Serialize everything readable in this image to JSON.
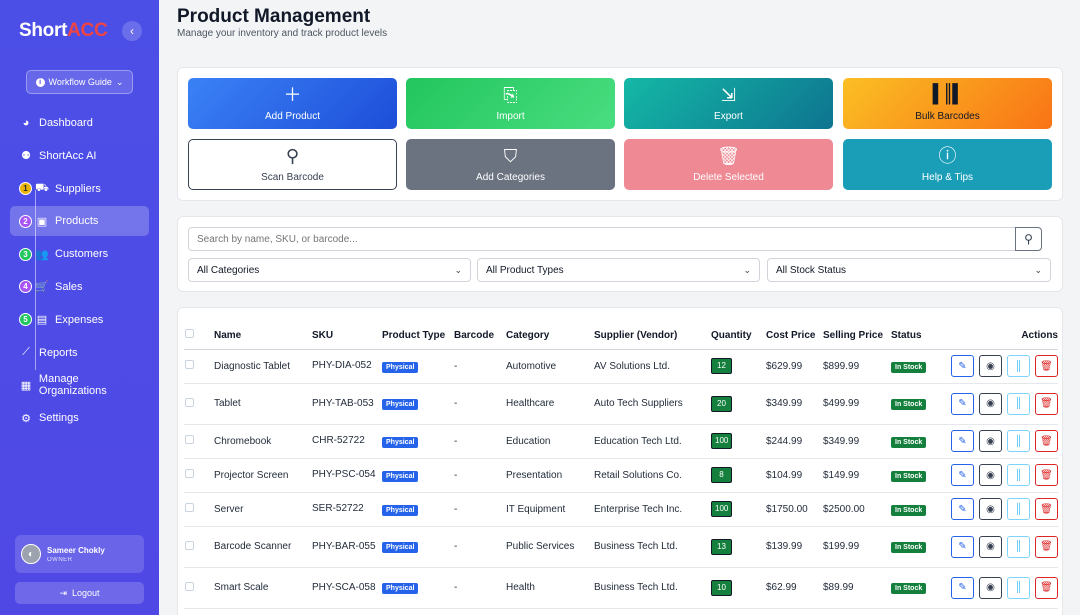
{
  "brand": {
    "part1": "Short",
    "part2": "ACC"
  },
  "sidebar": {
    "workflow_label": "Workflow Guide",
    "items": [
      {
        "label": "Dashboard",
        "icon": "palette-icon"
      },
      {
        "label": "ShortAcc AI",
        "icon": "robot-icon"
      },
      {
        "label": "Suppliers",
        "icon": "truck-icon",
        "step": "1"
      },
      {
        "label": "Products",
        "icon": "box-icon",
        "step": "2",
        "active": true
      },
      {
        "label": "Customers",
        "icon": "users-icon",
        "step": "3"
      },
      {
        "label": "Sales",
        "icon": "cart-icon",
        "step": "4"
      },
      {
        "label": "Expenses",
        "icon": "money-icon",
        "step": "5"
      },
      {
        "label": "Reports",
        "icon": "chart-icon"
      },
      {
        "label": "Manage Organizations",
        "icon": "building-icon"
      },
      {
        "label": "Settings",
        "icon": "gear-icon"
      }
    ],
    "user": {
      "name": "Sameer Chokly",
      "role": "OWNER"
    },
    "logout": "Logout"
  },
  "header": {
    "title": "Product Management",
    "subtitle": "Manage your inventory and track product levels"
  },
  "actions": {
    "add": "Add Product",
    "import": "Import",
    "export": "Export",
    "bulk": "Bulk Barcodes",
    "scan": "Scan Barcode",
    "categories": "Add Categories",
    "delete": "Delete Selected",
    "help": "Help & Tips"
  },
  "filters": {
    "search_placeholder": "Search by name, SKU, or barcode...",
    "category": "All Categories",
    "type": "All Product Types",
    "stock": "All Stock Status"
  },
  "table": {
    "headers": {
      "name": "Name",
      "sku": "SKU",
      "type": "Product Type",
      "barcode": "Barcode",
      "category": "Category",
      "supplier": "Supplier (Vendor)",
      "quantity": "Quantity",
      "cost": "Cost Price",
      "selling": "Selling Price",
      "status": "Status",
      "actions": "Actions"
    },
    "rows": [
      {
        "name": "Diagnostic Tablet",
        "sku": "PHY-DIA-052",
        "type": "Physical",
        "barcode": "-",
        "category": "Automotive",
        "supplier": "AV Solutions Ltd.",
        "qty": "12",
        "cost": "$629.99",
        "selling": "$899.99",
        "status": "In Stock"
      },
      {
        "name": "Tablet",
        "sku": "PHY-TAB-053",
        "type": "Physical",
        "barcode": "-",
        "category": "Healthcare",
        "supplier": "Auto Tech Suppliers",
        "qty": "20",
        "cost": "$349.99",
        "selling": "$499.99",
        "status": "In Stock"
      },
      {
        "name": "Chromebook",
        "sku": "CHR-52722",
        "type": "Physical",
        "barcode": "-",
        "category": "Education",
        "supplier": "Education Tech Ltd.",
        "qty": "100",
        "cost": "$244.99",
        "selling": "$349.99",
        "status": "In Stock"
      },
      {
        "name": "Projector Screen",
        "sku": "PHY-PSC-054",
        "type": "Physical",
        "barcode": "-",
        "category": "Presentation",
        "supplier": "Retail Solutions Co.",
        "qty": "8",
        "cost": "$104.99",
        "selling": "$149.99",
        "status": "In Stock"
      },
      {
        "name": "Server",
        "sku": "SER-52722",
        "type": "Physical",
        "barcode": "-",
        "category": "IT Equipment",
        "supplier": "Enterprise Tech Inc.",
        "qty": "100",
        "cost": "$1750.00",
        "selling": "$2500.00",
        "status": "In Stock"
      },
      {
        "name": "Barcode Scanner",
        "sku": "PHY-BAR-055",
        "type": "Physical",
        "barcode": "-",
        "category": "Public Services",
        "supplier": "Business Tech Ltd.",
        "qty": "13",
        "cost": "$139.99",
        "selling": "$199.99",
        "status": "In Stock"
      },
      {
        "name": "Smart Scale",
        "sku": "PHY-SCA-058",
        "type": "Physical",
        "barcode": "-",
        "category": "Health",
        "supplier": "Business Tech Ltd.",
        "qty": "10",
        "cost": "$62.99",
        "selling": "$89.99",
        "status": "In Stock"
      }
    ]
  }
}
